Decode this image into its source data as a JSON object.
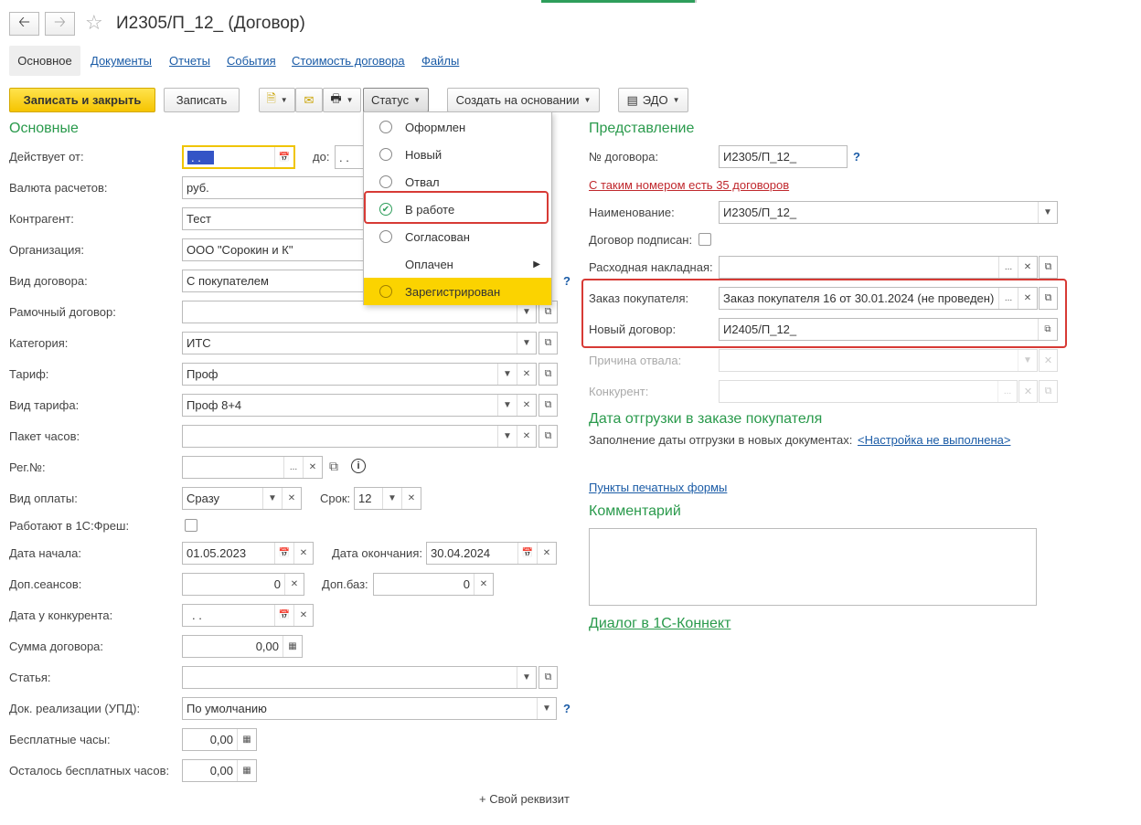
{
  "window": {
    "title": "И2305/П_12_ (Договор)"
  },
  "tabs": [
    "Основное",
    "Документы",
    "Отчеты",
    "События",
    "Стоимость договора",
    "Файлы"
  ],
  "toolbar": {
    "save_close": "Записать и закрыть",
    "save": "Записать",
    "status": "Статус",
    "create_based": "Создать на основании",
    "edo": "ЭДО"
  },
  "status_menu": {
    "items": [
      "Оформлен",
      "Новый",
      "Отвал",
      "В работе",
      "Согласован",
      "Оплачен",
      "Зарегистрирован"
    ],
    "selected": "В работе",
    "highlighted": "Зарегистрирован"
  },
  "left": {
    "section": "Основные",
    "active_from_label": "Действует от:",
    "active_from": ". .",
    "to_label": "до:",
    "to_value": ". .",
    "currency_label": "Валюта расчетов:",
    "currency": "руб.",
    "counterparty_label": "Контрагент:",
    "counterparty": "Тест",
    "org_label": "Организация:",
    "org": "ООО \"Сорокин и К\"",
    "contract_type_label": "Вид договора:",
    "contract_type": "С покупателем",
    "frame_label": "Рамочный договор:",
    "frame": "",
    "category_label": "Категория:",
    "category": "ИТС",
    "tariff_label": "Тариф:",
    "tariff": "Проф",
    "tariff_type_label": "Вид тарифа:",
    "tariff_type": "Проф 8+4",
    "hours_pack_label": "Пакет часов:",
    "hours_pack": "",
    "regno_label": "Рег.№:",
    "regno": "",
    "payment_label": "Вид оплаты:",
    "payment": "Сразу",
    "term_label": "Срок:",
    "term": "12",
    "fresh_label": "Работают в 1С:Фреш:",
    "start_label": "Дата начала:",
    "start": "01.05.2023",
    "end_label": "Дата окончания:",
    "end": "30.04.2024",
    "sessions_label": "Доп.сеансов:",
    "sessions": "0",
    "bases_label": "Доп.баз:",
    "bases": "0",
    "competitor_date_label": "Дата у конкурента:",
    "competitor_date": ". .",
    "sum_label": "Сумма договора:",
    "sum": "0,00",
    "article_label": "Статья:",
    "article": "",
    "upd_label": "Док. реализации (УПД):",
    "upd": "По умолчанию",
    "free_hours_label": "Бесплатные часы:",
    "free_hours": "0,00",
    "free_left_label": "Осталось бесплатных часов:",
    "free_left": "0,00",
    "custom_prop": "+ Свой реквизит"
  },
  "right": {
    "section": "Представление",
    "number_label": "№ договора:",
    "number": "И2305/П_12_",
    "dup_warning": "С таким номером есть 35 договоров",
    "name_label": "Наименование:",
    "name": "И2305/П_12_",
    "signed_label": "Договор подписан:",
    "invoice_label": "Расходная накладная:",
    "invoice": "",
    "order_label": "Заказ покупателя:",
    "order": "Заказ покупателя 16 от 30.01.2024 (не проведен)",
    "new_contract_label": "Новый договор:",
    "new_contract": "И2405/П_12_",
    "reason_label": "Причина отвала:",
    "competitor_label": "Конкурент:",
    "ship_section": "Дата отгрузки в заказе покупателя",
    "ship_fill_label": "Заполнение даты отгрузки в новых документах:",
    "ship_link": "<Настройка не выполнена>",
    "print_points": "Пункты печатных формы",
    "comment_section": "Комментарий",
    "dialog_link": "Диалог в 1С-Коннект"
  },
  "colors": {
    "accent": "#2a9a4c",
    "primary_btn": "#f5c400",
    "highlight": "#d73a35",
    "link": "#1a5ba6"
  }
}
